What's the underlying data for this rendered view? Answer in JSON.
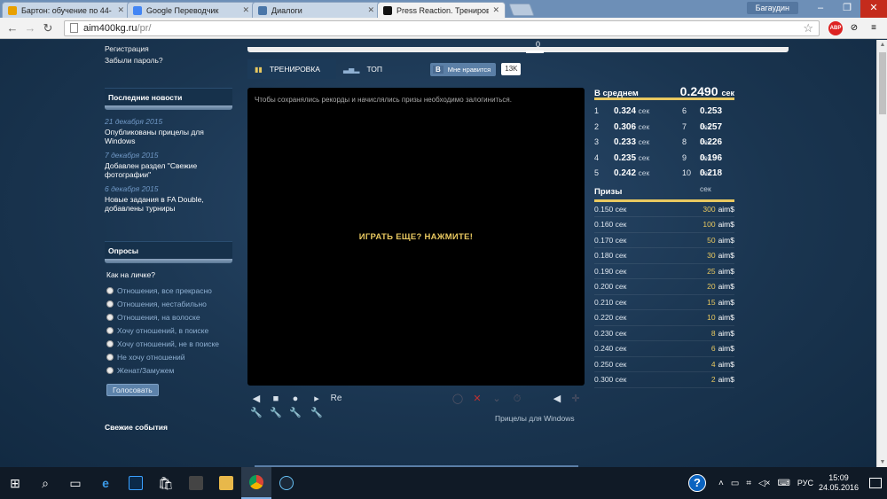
{
  "browser": {
    "tabs": [
      {
        "title": "Бартон: обучение по 44-",
        "color": "#e8a000"
      },
      {
        "title": "Google Переводчик",
        "color": "#4285f4"
      },
      {
        "title": "Диалоги",
        "color": "#4a76a8"
      },
      {
        "title": "Press Reaction. Трениров",
        "color": "#111111"
      }
    ],
    "user": "Багаудин",
    "url_host": "aim400kg.ru",
    "url_path": "/pr/",
    "abp_label": "ABP"
  },
  "sidebar": {
    "register": "Регистрация",
    "forgot": "Забыли пароль?",
    "news_title": "Последние новости",
    "news": [
      {
        "date": "21 декабря 2015",
        "text": "Опубликованы прицелы для Windows"
      },
      {
        "date": "7 декабря 2015",
        "text": "Добавлен раздел \"Свежие фотографии\""
      },
      {
        "date": "6 декабря 2015",
        "text": "Новые задания в FA Double, добавлены турниры"
      }
    ],
    "polls_title": "Опросы",
    "poll_question": "Как на личке?",
    "poll_options": [
      "Отношения, все прекрасно",
      "Отношения, нестабильно",
      "Отношения, на волоске",
      "Хочу отношений, в поиске",
      "Хочу отношений, не в поиске",
      "Не хочу отношений",
      "Женат/Замужем"
    ],
    "vote_button": "Голосовать",
    "events_title": "Свежие события"
  },
  "game": {
    "tab_training": "ТРЕНИРОВКА",
    "tab_top": "ТОП",
    "vk_logo": "В",
    "vk_like": "Мне нравится",
    "vk_count": "13K",
    "note": "Чтобы сохранялись рекорды и начислялись призы необходимо залогиниться.",
    "play_again": "ИГРАТЬ ЕЩЕ? НАЖМИТЕ!",
    "re_label": "Re",
    "slider_value": "0",
    "windows_link": "Прицелы для Windows"
  },
  "stats": {
    "avg_label": "В среднем",
    "avg_value": "0.2490",
    "unit": "сек",
    "records": [
      {
        "n": "1",
        "t": "0.324"
      },
      {
        "n": "6",
        "t": "0.253"
      },
      {
        "n": "2",
        "t": "0.306"
      },
      {
        "n": "7",
        "t": "0.257"
      },
      {
        "n": "3",
        "t": "0.233"
      },
      {
        "n": "8",
        "t": "0.226"
      },
      {
        "n": "4",
        "t": "0.235"
      },
      {
        "n": "9",
        "t": "0.196"
      },
      {
        "n": "5",
        "t": "0.242"
      },
      {
        "n": "10",
        "t": "0.218"
      }
    ],
    "prizes_title": "Призы",
    "currency": "aim$",
    "prizes": [
      {
        "time": "0.150 сек",
        "value": "300"
      },
      {
        "time": "0.160 сек",
        "value": "100"
      },
      {
        "time": "0.170 сек",
        "value": "50"
      },
      {
        "time": "0.180 сек",
        "value": "30"
      },
      {
        "time": "0.190 сек",
        "value": "25"
      },
      {
        "time": "0.200 сек",
        "value": "20"
      },
      {
        "time": "0.210 сек",
        "value": "15"
      },
      {
        "time": "0.220 сек",
        "value": "10"
      },
      {
        "time": "0.230 сек",
        "value": "8"
      },
      {
        "time": "0.240 сек",
        "value": "6"
      },
      {
        "time": "0.250 сек",
        "value": "4"
      },
      {
        "time": "0.300 сек",
        "value": "2"
      }
    ]
  },
  "taskbar": {
    "lang": "РУС",
    "time": "15:09",
    "date": "24.05.2016"
  }
}
